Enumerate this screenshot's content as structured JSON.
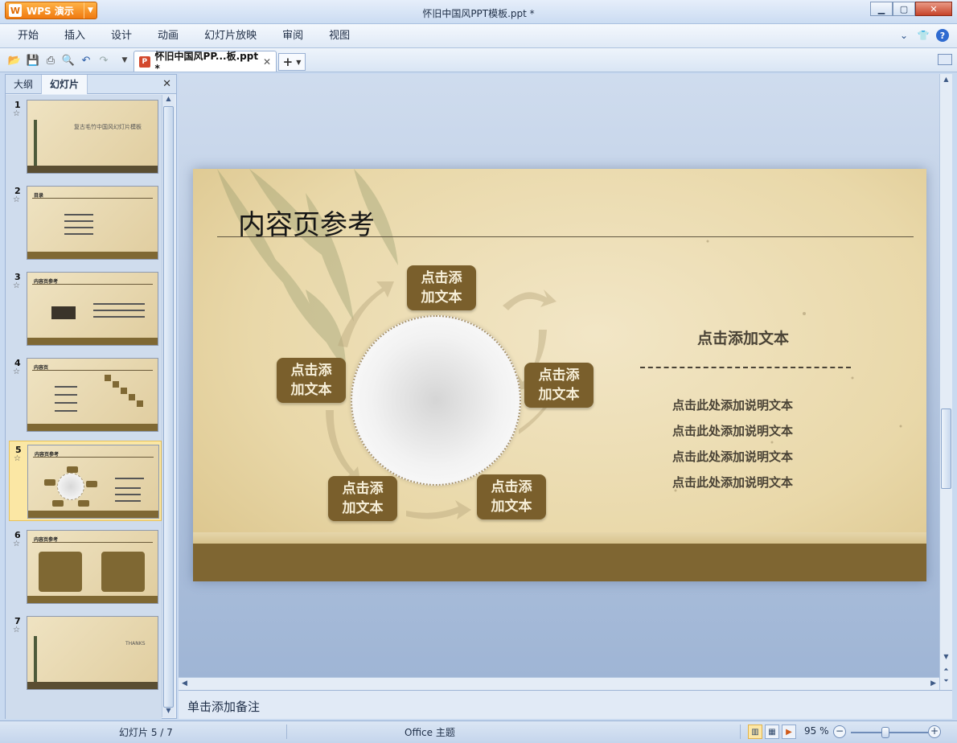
{
  "app": {
    "menu_label": "WPS 演示",
    "window_title": "怀旧中国风PPT模板.ppt *"
  },
  "menu": {
    "items": [
      "开始",
      "插入",
      "设计",
      "动画",
      "幻灯片放映",
      "审阅",
      "视图"
    ]
  },
  "toolbar": {
    "doc_tab": "怀旧中国风PP...板.ppt *",
    "icons": [
      "open-icon",
      "save-icon",
      "print-icon",
      "print-preview-icon",
      "undo-icon",
      "redo-icon",
      "customize-icon"
    ]
  },
  "left_panel": {
    "tabs": [
      "大纲",
      "幻灯片"
    ],
    "active_tab": "幻灯片",
    "slides": [
      {
        "num": "1",
        "title": "",
        "subtitle": "复古毛竹中国风幻灯片模板"
      },
      {
        "num": "2",
        "title": "目录",
        "subtitle": ""
      },
      {
        "num": "3",
        "title": "内容页参考",
        "subtitle": ""
      },
      {
        "num": "4",
        "title": "内容页",
        "subtitle": ""
      },
      {
        "num": "5",
        "title": "内容页参考",
        "subtitle": ""
      },
      {
        "num": "6",
        "title": "内容页参考",
        "subtitle": ""
      },
      {
        "num": "7",
        "title": "",
        "subtitle": "THANKS"
      }
    ],
    "selected_slide": 5
  },
  "slide": {
    "title": "内容页参考",
    "nodes": [
      {
        "line1": "点击添",
        "line2": "加文本"
      },
      {
        "line1": "点击添",
        "line2": "加文本"
      },
      {
        "line1": "点击添",
        "line2": "加文本"
      },
      {
        "line1": "点击添",
        "line2": "加文本"
      },
      {
        "line1": "点击添",
        "line2": "加文本"
      }
    ],
    "right_title": "点击添加文本",
    "descriptions": [
      "点击此处添加说明文本",
      "点击此处添加说明文本",
      "点击此处添加说明文本",
      "点击此处添加说明文本"
    ]
  },
  "notes": {
    "placeholder": "单击添加备注"
  },
  "status": {
    "slide_counter": "幻灯片 5 / 7",
    "theme": "Office 主题",
    "zoom": "95 %",
    "zoom_fraction": 0.45
  },
  "colors": {
    "accent": "#f07a10",
    "slide_brown": "#7f6632",
    "node_brown": "#7a5f2c"
  }
}
